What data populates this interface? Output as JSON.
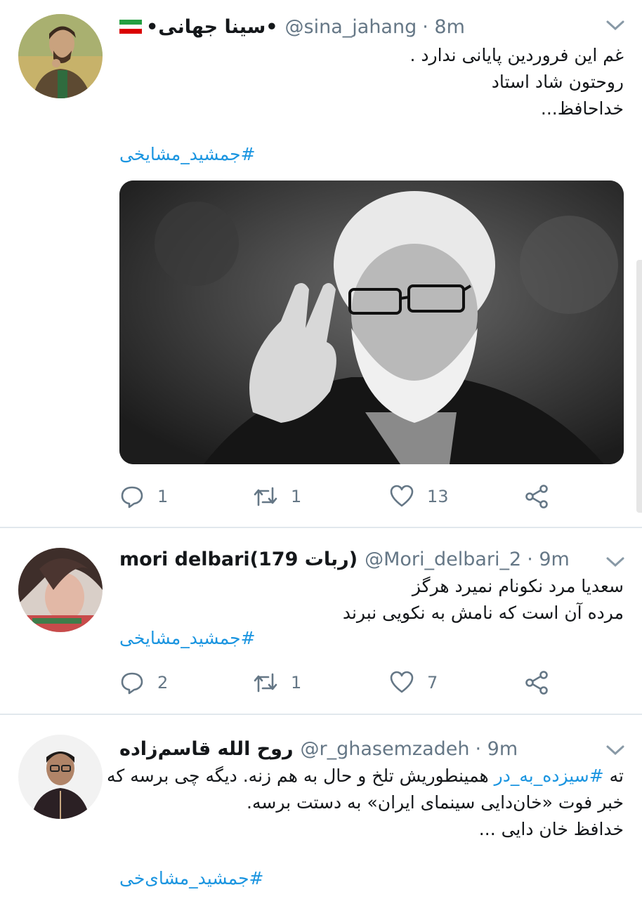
{
  "tweets": [
    {
      "name": "•سینا جهانی•",
      "handle": "@sina_jahang",
      "time": "· 8m",
      "lines": [
        "غم این فروردین پایانی ندارد .",
        "روحتون شاد استاد",
        "خداحافظ..."
      ],
      "hashtag": "#جمشید_مشایخی",
      "counts": {
        "reply": "1",
        "retweet": "1",
        "like": "13"
      }
    },
    {
      "name": "mori delbari(179 ربات)",
      "handle": "@Mori_delbari_2",
      "time": "· 9m",
      "lines": [
        "سعدیا مرد نکونام نمیرد هرگز",
        "مرده آن است که نامش به نکویی نبرند"
      ],
      "hashtag": "#جمشید_مشایخی",
      "counts": {
        "reply": "2",
        "retweet": "1",
        "like": "7"
      }
    },
    {
      "name": "روح الله قاسم‌زاده",
      "handle": "@r_ghasemzadeh",
      "time": "· 9m",
      "line1_prefix": "ته ",
      "line1_link": "#سیزده_به_در",
      "line1_rest": " همینطوریش تلخ و حال به هم زنه. دیگه چی برسه که",
      "lines": [
        "خبر فوت «خان‌دایی سینمای ایران» به دستت برسه.",
        "خدافظ خان دایی ..."
      ],
      "hashtag": "#جمشید_مشای‌خی"
    }
  ],
  "icons": {
    "reply": "reply-icon",
    "retweet": "retweet-icon",
    "like": "like-icon",
    "share": "share-icon",
    "more": "chevron-down-icon"
  },
  "colors": {
    "link": "#1b95e0",
    "secondary": "#657786",
    "divider": "#e1e8ed"
  }
}
